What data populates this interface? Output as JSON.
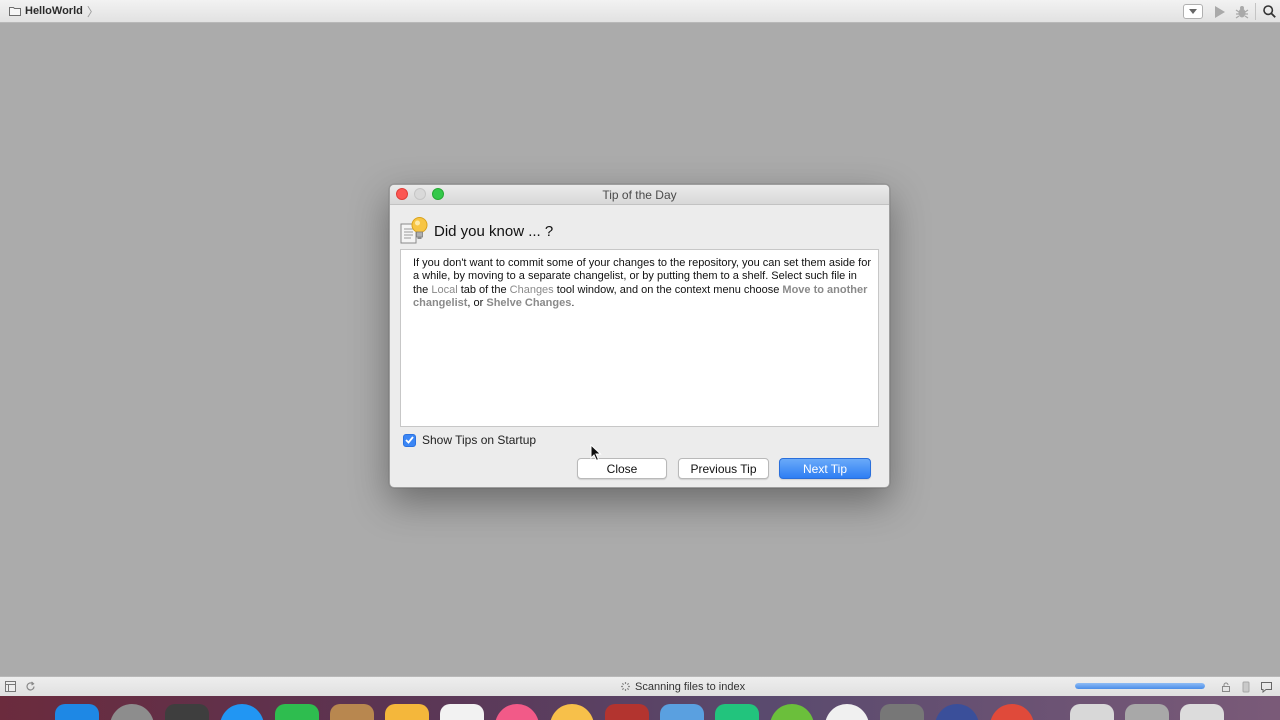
{
  "navbar": {
    "project_name": "HelloWorld",
    "icons": [
      "folder-icon",
      "run-config-dropdown",
      "run-icon",
      "debug-icon",
      "search-icon"
    ]
  },
  "dialog": {
    "title": "Tip of the Day",
    "heading": "Did you know ... ?",
    "tip": {
      "t1": "If you don't want to commit some of your changes to the repository, you can set them aside for a while, by moving to a separate changelist, or by putting them to a shelf. Select such file in the ",
      "h1": "Local",
      "t2": " tab of the ",
      "h2": "Changes",
      "t3": " tool window, and on the context menu choose ",
      "h3": "Move to another changelist",
      "t4": ", or ",
      "h4": "Shelve Changes",
      "t5": "."
    },
    "show_tips_label": "Show Tips on Startup",
    "show_tips_checked": true,
    "buttons": {
      "close": "Close",
      "previous": "Previous Tip",
      "next": "Next Tip"
    }
  },
  "statusbar": {
    "message": "Scanning files to index",
    "progress_fraction": 1.0
  },
  "colors": {
    "accent": "#3b86f5",
    "close_light": "#fc5753",
    "zoom_light": "#34c84a",
    "background": "#ababab"
  },
  "dock": {
    "icons": [
      "finder-icon",
      "launchpad-icon",
      "calendar-icon",
      "app-store-icon",
      "facetime-icon",
      "contacts-icon",
      "notes-icon",
      "calendar-date-icon",
      "itunes-icon",
      "photo-booth-icon",
      "photos-icon",
      "xcode-icon",
      "pycharm-icon",
      "android-studio-icon",
      "picasa-icon",
      "system-preferences-icon",
      "quicktime-icon",
      "chrome-icon",
      "documents-icon",
      "downloads-icon",
      "trash-icon"
    ]
  }
}
